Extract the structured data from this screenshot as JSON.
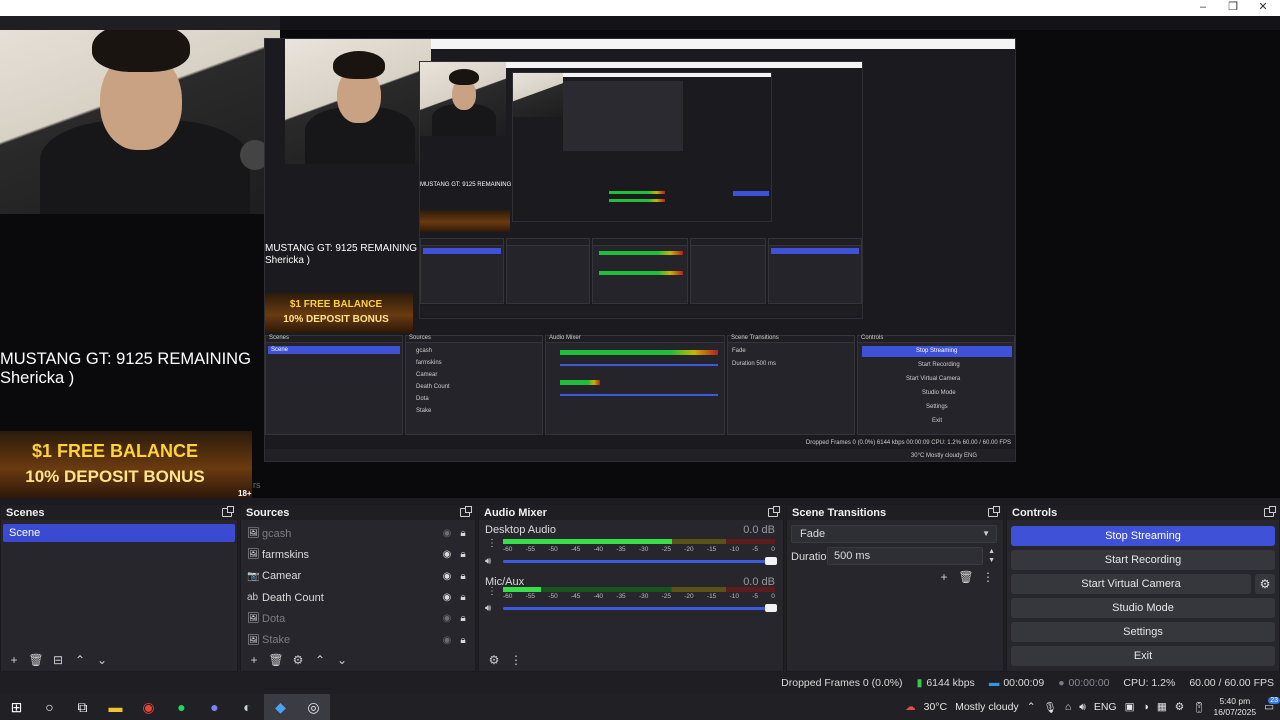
{
  "window": {
    "controls": {
      "minimize": "–",
      "maximize": "❐",
      "close": "✕"
    }
  },
  "preview": {
    "overlay_title": "MUSTANG GT: 9125 REMAINING",
    "overlay_subtitle": "Shericka  )",
    "promo_line1": "$1 FREE BALANCE",
    "promo_line2": "10% DEPOSIT BONUS",
    "promo_badge": "18+",
    "partial_tab_text": "rs"
  },
  "scenes": {
    "title": "Scenes",
    "items": [
      "Scene"
    ],
    "tools": {
      "add": "+",
      "remove": "🗑",
      "filter": "⊟",
      "up": "⌃",
      "down": "⌄"
    }
  },
  "sources": {
    "title": "Sources",
    "items": [
      {
        "icon": "🖼",
        "icon_name": "image-icon",
        "name": "gcash",
        "visible": false
      },
      {
        "icon": "🖼",
        "icon_name": "image-icon",
        "name": "farmskins",
        "visible": true
      },
      {
        "icon": "📷",
        "icon_name": "camera-icon",
        "name": "Camear",
        "visible": true
      },
      {
        "icon": "ab",
        "icon_name": "text-icon",
        "name": "Death Count",
        "visible": true
      },
      {
        "icon": "🖼",
        "icon_name": "image-icon",
        "name": "Dota",
        "visible": false
      },
      {
        "icon": "🖼",
        "icon_name": "image-icon",
        "name": "Stake",
        "visible": false
      }
    ],
    "tools": {
      "add": "+",
      "remove": "🗑",
      "settings": "⚙",
      "up": "⌃",
      "down": "⌄"
    }
  },
  "mixer": {
    "title": "Audio Mixer",
    "channels": [
      {
        "name": "Desktop Audio",
        "db": "0.0 dB",
        "level": 0.62
      },
      {
        "name": "Mic/Aux",
        "db": "0.0 dB",
        "level": 0.14
      }
    ],
    "ticks": [
      "-60",
      "-55",
      "-50",
      "-45",
      "-40",
      "-35",
      "-30",
      "-25",
      "-20",
      "-15",
      "-10",
      "-5",
      "0"
    ],
    "tools": {
      "settings": "⚙",
      "menu": "⋮"
    }
  },
  "transitions": {
    "title": "Scene Transitions",
    "selected": "Fade",
    "duration_label": "Duration",
    "duration_value": "500 ms",
    "tools": {
      "add": "+",
      "remove": "🗑",
      "menu": "⋮"
    }
  },
  "controls": {
    "title": "Controls",
    "buttons": {
      "stop_streaming": "Stop Streaming",
      "start_recording": "Start Recording",
      "start_virtual_camera": "Start Virtual Camera",
      "studio_mode": "Studio Mode",
      "settings": "Settings",
      "exit": "Exit"
    },
    "gear": "⚙"
  },
  "status": {
    "dropped_frames": "Dropped Frames 0 (0.0%)",
    "bitrate": "6144 kbps",
    "stream_time": "00:00:09",
    "record_time": "00:00:00",
    "cpu": "CPU: 1.2%",
    "fps": "60.00 / 60.00 FPS",
    "colors": {
      "live": "#2e9ae6",
      "bars": "#3ac94a"
    }
  },
  "taskbar": {
    "weather_temp": "30°C",
    "weather_text": "Mostly cloudy",
    "language": "ENG",
    "time": "5:40 pm",
    "date": "16/07/2025",
    "notification_count": "23"
  },
  "theme": {
    "accent": "#3f51d6",
    "panel": "#26262c",
    "header": "#1e1e23"
  }
}
